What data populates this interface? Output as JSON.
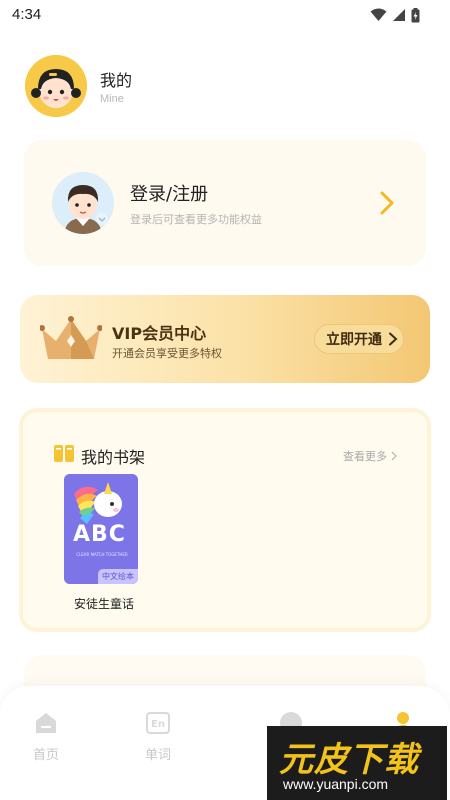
{
  "status_bar": {
    "time": "4:34"
  },
  "header": {
    "title": "我的",
    "subtitle": "Mine"
  },
  "login_card": {
    "title": "登录/注册",
    "subtitle": "登录后可查看更多功能权益"
  },
  "vip": {
    "title": "VIP会员中心",
    "subtitle": "开通会员享受更多特权",
    "button_label": "立即开通"
  },
  "bookshelf": {
    "title": "我的书架",
    "more_label": "查看更多",
    "books": [
      {
        "title": "安徒生童话",
        "cover_text": "ABC",
        "cover_small_text": "CLEAR MATCH TOGETHER",
        "tag": "中文绘本"
      }
    ]
  },
  "tabs": [
    {
      "label": "首页",
      "icon": "home-icon"
    },
    {
      "label": "单词",
      "icon": "en-word-icon"
    }
  ],
  "watermark": {
    "text": "元皮下载",
    "url": "www.yuanpi.com"
  },
  "colors": {
    "accent": "#f7c948",
    "vip_gradient_end": "#f3c773",
    "book_cover": "#7d74e8",
    "tab_inactive": "#c8c8c8"
  }
}
